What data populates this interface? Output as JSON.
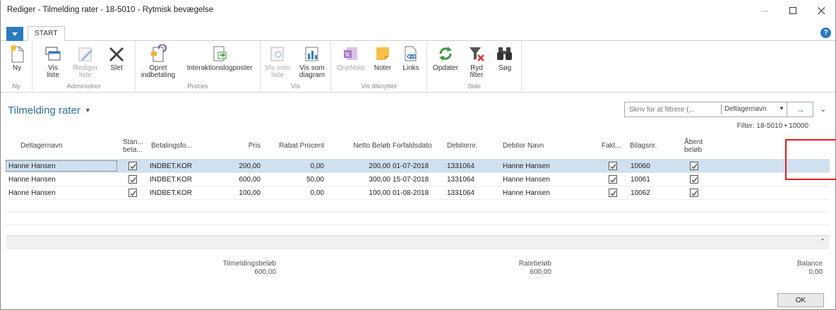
{
  "window": {
    "title": "Rediger - Tilmelding rater - 18-5010 - Rytmisk bevægelse",
    "controls": [
      "minimize-icon",
      "maximize-icon",
      "close-icon"
    ]
  },
  "ribbon": {
    "tab": "START",
    "groups": [
      {
        "label": "Ny",
        "buttons": [
          {
            "label": "Ny",
            "icon": "new-document-icon"
          }
        ]
      },
      {
        "label": "Administrer",
        "buttons": [
          {
            "label": "Vis\nliste",
            "icon": "view-list-icon"
          },
          {
            "label": "Rediger\nliste",
            "icon": "edit-list-icon",
            "disabled": true
          },
          {
            "label": "Slet",
            "icon": "delete-x-icon"
          }
        ]
      },
      {
        "label": "Proces",
        "buttons": [
          {
            "label": "Opret\nindbetaling",
            "icon": "create-payment-icon"
          },
          {
            "label": "Interaktionslogposter",
            "icon": "interaction-log-icon"
          }
        ]
      },
      {
        "label": "Vis",
        "buttons": [
          {
            "label": "Vis som\nliste",
            "icon": "view-as-list-icon",
            "disabled": true
          },
          {
            "label": "Vis som\ndiagram",
            "icon": "view-as-chart-icon"
          }
        ]
      },
      {
        "label": "Vis tilknyttet",
        "buttons": [
          {
            "label": "OneNote",
            "icon": "onenote-icon",
            "disabled": true
          },
          {
            "label": "Noter",
            "icon": "notes-icon"
          },
          {
            "label": "Links",
            "icon": "links-icon"
          }
        ]
      },
      {
        "label": "Side",
        "buttons": [
          {
            "label": "Opdater",
            "icon": "refresh-icon"
          },
          {
            "label": "Ryd\nfilter",
            "icon": "clear-filter-icon"
          },
          {
            "label": "Søg",
            "icon": "binoculars-icon"
          }
        ]
      }
    ]
  },
  "page": {
    "title": "Tilmelding rater",
    "filter_placeholder": "Skriv for at filtrere (...",
    "filter_field": "Deltagernavn",
    "filter_info": "Filter: 18-5010 • 10000"
  },
  "grid": {
    "columns": [
      "Deltagernavn",
      "Stan...\nbeta...",
      "Betalingsfo...",
      "Pris",
      "Rabat Procent",
      "Netto Beløb",
      "Forfaldsdato",
      "Debitornr.",
      "Debitor Navn",
      "Fakt...",
      "Bilagsnr.",
      "Åbent\nbeløb"
    ],
    "rows": [
      {
        "deltager": "Hanne Hansen",
        "std": true,
        "betaling": "INDBET.KOR",
        "pris": "200,00",
        "rabat": "0,00",
        "netto": "200,00",
        "forfald": "01-07-2018",
        "debnr": "1331064",
        "debnavn": "Hanne Hansen",
        "fakt": true,
        "bilag": "10060",
        "aaben": true
      },
      {
        "deltager": "Hanne Hansen",
        "std": true,
        "betaling": "INDBET.KOR",
        "pris": "600,00",
        "rabat": "50,00",
        "netto": "300,00",
        "forfald": "15-07-2018",
        "debnr": "1331064",
        "debnavn": "Hanne Hansen",
        "fakt": true,
        "bilag": "10061",
        "aaben": true
      },
      {
        "deltager": "Hanne Hansen",
        "std": true,
        "betaling": "INDBET.KOR",
        "pris": "100,00",
        "rabat": "0,00",
        "netto": "100,00",
        "forfald": "01-08-2018",
        "debnr": "1331064",
        "debnavn": "Hanne Hansen",
        "fakt": true,
        "bilag": "10062",
        "aaben": true
      }
    ]
  },
  "totals": {
    "tilmelding_label": "Tilmeldingsbeløb",
    "tilmelding_value": "600,00",
    "rate_label": "Ratebeløb",
    "rate_value": "600,00",
    "balance_label": "Balance",
    "balance_value": "0,00"
  },
  "ok_label": "OK",
  "colors": {
    "accent": "#2b7bc0",
    "selection": "#cfe0f1",
    "annotation": "#e02020"
  }
}
